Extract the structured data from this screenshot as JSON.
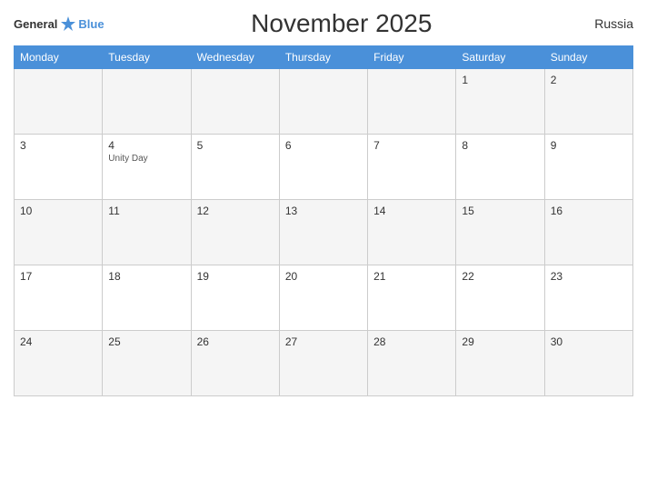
{
  "header": {
    "logo_general": "General",
    "logo_blue": "Blue",
    "title": "November 2025",
    "country": "Russia"
  },
  "columns": [
    "Monday",
    "Tuesday",
    "Wednesday",
    "Thursday",
    "Friday",
    "Saturday",
    "Sunday"
  ],
  "weeks": [
    {
      "days": [
        {
          "number": "",
          "event": ""
        },
        {
          "number": "",
          "event": ""
        },
        {
          "number": "",
          "event": ""
        },
        {
          "number": "",
          "event": ""
        },
        {
          "number": "",
          "event": ""
        },
        {
          "number": "1",
          "event": ""
        },
        {
          "number": "2",
          "event": ""
        }
      ]
    },
    {
      "days": [
        {
          "number": "3",
          "event": ""
        },
        {
          "number": "4",
          "event": "Unity Day"
        },
        {
          "number": "5",
          "event": ""
        },
        {
          "number": "6",
          "event": ""
        },
        {
          "number": "7",
          "event": ""
        },
        {
          "number": "8",
          "event": ""
        },
        {
          "number": "9",
          "event": ""
        }
      ]
    },
    {
      "days": [
        {
          "number": "10",
          "event": ""
        },
        {
          "number": "11",
          "event": ""
        },
        {
          "number": "12",
          "event": ""
        },
        {
          "number": "13",
          "event": ""
        },
        {
          "number": "14",
          "event": ""
        },
        {
          "number": "15",
          "event": ""
        },
        {
          "number": "16",
          "event": ""
        }
      ]
    },
    {
      "days": [
        {
          "number": "17",
          "event": ""
        },
        {
          "number": "18",
          "event": ""
        },
        {
          "number": "19",
          "event": ""
        },
        {
          "number": "20",
          "event": ""
        },
        {
          "number": "21",
          "event": ""
        },
        {
          "number": "22",
          "event": ""
        },
        {
          "number": "23",
          "event": ""
        }
      ]
    },
    {
      "days": [
        {
          "number": "24",
          "event": ""
        },
        {
          "number": "25",
          "event": ""
        },
        {
          "number": "26",
          "event": ""
        },
        {
          "number": "27",
          "event": ""
        },
        {
          "number": "28",
          "event": ""
        },
        {
          "number": "29",
          "event": ""
        },
        {
          "number": "30",
          "event": ""
        }
      ]
    }
  ]
}
